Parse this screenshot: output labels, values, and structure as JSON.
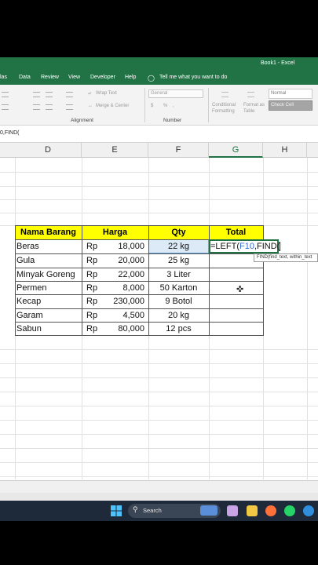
{
  "window": {
    "title": "Book1 - Excel"
  },
  "tabs": [
    "las",
    "Data",
    "Review",
    "View",
    "Developer",
    "Help",
    "Tell me what you want to do"
  ],
  "ribbon": {
    "wrap_text": "Wrap Text",
    "merge_center": "Merge & Center",
    "alignment_label": "Alignment",
    "number_format": "General",
    "number_label": "Number",
    "conditional_formatting": "Conditional Formatting",
    "format_as_table": "Format as Table",
    "style_normal": "Normal",
    "style_check_cell": "Check Cell",
    "currency": "$",
    "percent": "%",
    "comma": ","
  },
  "formula_bar": {
    "text": "0,FIND("
  },
  "columns": [
    "D",
    "E",
    "F",
    "G",
    "H"
  ],
  "table": {
    "headers": [
      "Nama Barang",
      "Harga",
      "Qty",
      "Total"
    ],
    "currency": "Rp",
    "rows": [
      {
        "nama": "Beras",
        "harga": "18,000",
        "qty": "22 kg"
      },
      {
        "nama": "Gula",
        "harga": "20,000",
        "qty": "25 kg"
      },
      {
        "nama": "Minyak Goreng",
        "harga": "22,000",
        "qty": "3 Liter"
      },
      {
        "nama": "Permen",
        "harga": "8,000",
        "qty": "50 Karton"
      },
      {
        "nama": "Kecap",
        "harga": "230,000",
        "qty": "9 Botol"
      },
      {
        "nama": "Garam",
        "harga": "4,500",
        "qty": "20 kg"
      },
      {
        "nama": "Sabun",
        "harga": "80,000",
        "qty": "12 pcs"
      }
    ]
  },
  "active_cell": {
    "formula_prefix": "=LEFT(",
    "formula_ref": "F10",
    "formula_suffix": ",FIND(",
    "tooltip": "FIND(find_text, within_text"
  },
  "taskbar": {
    "search_label": "Search"
  },
  "colors": {
    "excel_green": "#217346",
    "header_yellow": "#ffff00"
  }
}
